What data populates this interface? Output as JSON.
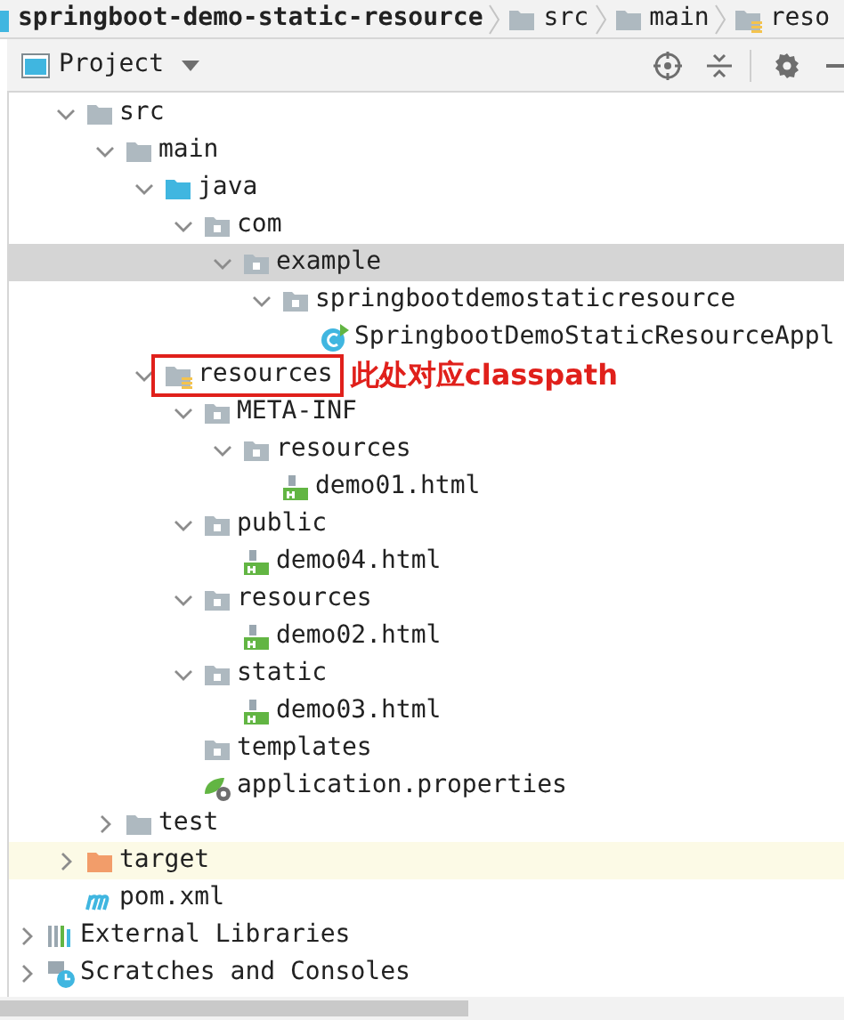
{
  "breadcrumb": [
    {
      "label": "springboot-demo-static-resource",
      "kind": "module"
    },
    {
      "label": "src",
      "kind": "folder"
    },
    {
      "label": "main",
      "kind": "folder"
    },
    {
      "label": "reso",
      "kind": "resource-folder"
    }
  ],
  "panel": {
    "title": "Project"
  },
  "tree": [
    {
      "children": [
        {
          "label": "src",
          "kind": "folder",
          "expanded": true,
          "selected": false,
          "highlighted": false,
          "children": [
            {
              "label": "main",
              "kind": "folder",
              "expanded": true,
              "selected": false,
              "highlighted": false,
              "children": [
                {
                  "label": "java",
                  "kind": "source-folder",
                  "expanded": true,
                  "selected": false,
                  "highlighted": false,
                  "children": [
                    {
                      "label": "com",
                      "kind": "package",
                      "expanded": true,
                      "selected": false,
                      "highlighted": false,
                      "children": [
                        {
                          "label": "example",
                          "kind": "package",
                          "expanded": true,
                          "selected": true,
                          "highlighted": false,
                          "children": [
                            {
                              "label": "springbootdemostaticresource",
                              "kind": "package",
                              "expanded": true,
                              "selected": false,
                              "highlighted": false,
                              "children": [
                                {
                                  "label": "SpringbootDemoStaticResourceAppl",
                                  "kind": "class",
                                  "selected": false,
                                  "highlighted": false
                                }
                              ]
                            }
                          ]
                        }
                      ]
                    }
                  ]
                },
                {
                  "label": "resources",
                  "kind": "resource-folder",
                  "expanded": true,
                  "selected": false,
                  "highlighted": false,
                  "annotation": "此处对应classpath",
                  "children": [
                    {
                      "label": "META-INF",
                      "kind": "package",
                      "expanded": true,
                      "selected": false,
                      "highlighted": false,
                      "children": [
                        {
                          "label": "resources",
                          "kind": "package",
                          "expanded": true,
                          "selected": false,
                          "highlighted": false,
                          "children": [
                            {
                              "label": "demo01.html",
                              "kind": "html",
                              "selected": false,
                              "highlighted": false
                            }
                          ]
                        }
                      ]
                    },
                    {
                      "label": "public",
                      "kind": "package",
                      "expanded": true,
                      "selected": false,
                      "highlighted": false,
                      "children": [
                        {
                          "label": "demo04.html",
                          "kind": "html",
                          "selected": false,
                          "highlighted": false
                        }
                      ]
                    },
                    {
                      "label": "resources",
                      "kind": "package",
                      "expanded": true,
                      "selected": false,
                      "highlighted": false,
                      "children": [
                        {
                          "label": "demo02.html",
                          "kind": "html",
                          "selected": false,
                          "highlighted": false
                        }
                      ]
                    },
                    {
                      "label": "static",
                      "kind": "package",
                      "expanded": true,
                      "selected": false,
                      "highlighted": false,
                      "children": [
                        {
                          "label": "demo03.html",
                          "kind": "html",
                          "selected": false,
                          "highlighted": false
                        }
                      ]
                    },
                    {
                      "label": "templates",
                      "kind": "package",
                      "selected": false,
                      "highlighted": false
                    },
                    {
                      "label": "application.properties",
                      "kind": "properties",
                      "selected": false,
                      "highlighted": false
                    }
                  ]
                }
              ]
            },
            {
              "label": "test",
              "kind": "folder",
              "expanded": false,
              "selected": false,
              "highlighted": false
            }
          ]
        },
        {
          "label": "target",
          "kind": "excluded-folder",
          "expanded": false,
          "selected": false,
          "highlighted": true
        },
        {
          "label": "pom.xml",
          "kind": "maven",
          "selected": false,
          "highlighted": false
        }
      ]
    },
    {
      "label": "External Libraries",
      "kind": "libraries",
      "expanded": false,
      "selected": false,
      "highlighted": false
    },
    {
      "label": "Scratches and Consoles",
      "kind": "scratches",
      "expanded": false,
      "selected": false,
      "highlighted": false
    }
  ]
}
